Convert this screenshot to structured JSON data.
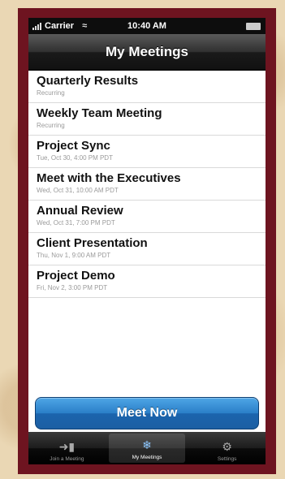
{
  "status_bar": {
    "carrier": "Carrier",
    "time": "10:40 AM"
  },
  "navbar": {
    "title": "My Meetings"
  },
  "meetings": [
    {
      "title": "Quarterly Results",
      "subtitle": "Recurring"
    },
    {
      "title": "Weekly Team Meeting",
      "subtitle": "Recurring"
    },
    {
      "title": "Project Sync",
      "subtitle": "Tue, Oct 30, 4:00 PM PDT"
    },
    {
      "title": "Meet with the Executives",
      "subtitle": "Wed, Oct 31, 10:00 AM PDT"
    },
    {
      "title": "Annual Review",
      "subtitle": "Wed, Oct 31, 7:00 PM PDT"
    },
    {
      "title": "Client Presentation",
      "subtitle": "Thu, Nov 1, 9:00 AM PDT"
    },
    {
      "title": "Project Demo",
      "subtitle": "Fri, Nov 2, 3:00 PM PDT"
    }
  ],
  "meet_now_label": "Meet Now",
  "tabs": [
    {
      "label": "Join a Meeting",
      "icon": "join-icon"
    },
    {
      "label": "My Meetings",
      "icon": "snowflake-icon"
    },
    {
      "label": "Settings",
      "icon": "gear-icon"
    }
  ],
  "colors": {
    "frame": "#6e1420",
    "accent": "#2a7fc8",
    "background": "#ead7b4"
  }
}
